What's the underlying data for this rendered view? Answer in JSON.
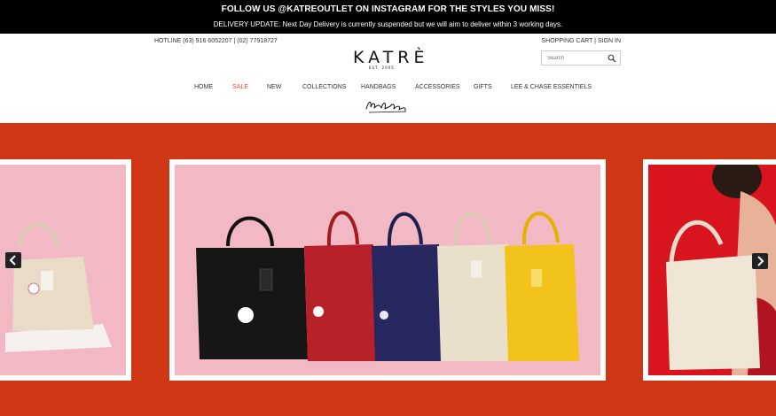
{
  "announcement": {
    "headline": "FOLLOW US @KATREOUTLET ON INSTAGRAM FOR THE STYLES YOU MISS!",
    "delivery": "DELIVERY UPDATE: Next Day Delivery is currently suspended but we will aim to deliver within 3 working days."
  },
  "utility": {
    "hotline": "HOTLINE (63) 916 6052207  | (02) 77918727",
    "cart": "SHOPPING CART",
    "separator": " | ",
    "signin": "SIGN IN"
  },
  "logo": {
    "text": "KATRÈ",
    "subtext": "EST. 2005"
  },
  "search": {
    "placeholder": "Search",
    "icon": "search-icon"
  },
  "nav": {
    "items": [
      "HOME",
      "SALE",
      "NEW",
      "COLLECTIONS",
      "HANDBAGS",
      "ACCESSORIES",
      "GIFTS",
      "LEE & CHASE ESSENTIELS"
    ],
    "active_color": "#e0443a"
  },
  "colors": {
    "topbar": "#000000",
    "hero": "#cf3613",
    "slide_bg": "#f2b8c3"
  },
  "carousel": {
    "prev_icon": "chevron-left-icon",
    "next_icon": "chevron-right-icon"
  }
}
